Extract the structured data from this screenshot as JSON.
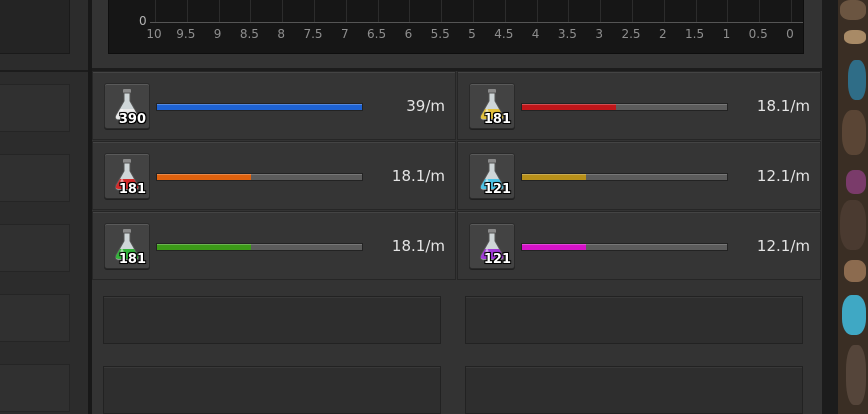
{
  "graph": {
    "zero_label": "0",
    "x_ticks": [
      "10",
      "9.5",
      "9",
      "8.5",
      "8",
      "7.5",
      "7",
      "6.5",
      "6",
      "5.5",
      "5",
      "4.5",
      "4",
      "3.5",
      "3",
      "2.5",
      "2",
      "1.5",
      "1",
      "0.5",
      "0"
    ]
  },
  "packs": [
    {
      "name": "white",
      "count": "390",
      "rate": "39/m",
      "fill": 1.0,
      "flask_color": "#e9e9e9",
      "bar_color": "#1e63d4"
    },
    {
      "name": "yellow",
      "count": "181",
      "rate": "18.1/m",
      "fill": 0.46,
      "flask_color": "#e3c13c",
      "bar_color": "#c0161a"
    },
    {
      "name": "red",
      "count": "181",
      "rate": "18.1/m",
      "fill": 0.46,
      "flask_color": "#d42a2a",
      "bar_color": "#e0620e"
    },
    {
      "name": "cyan",
      "count": "121",
      "rate": "12.1/m",
      "fill": 0.31,
      "flask_color": "#4cc3e6",
      "bar_color": "#b8901a"
    },
    {
      "name": "green",
      "count": "181",
      "rate": "18.1/m",
      "fill": 0.46,
      "flask_color": "#33b33a",
      "bar_color": "#3c9a18"
    },
    {
      "name": "purple",
      "count": "121",
      "rate": "12.1/m",
      "fill": 0.31,
      "flask_color": "#a03ad8",
      "bar_color": "#d612c8"
    }
  ]
}
